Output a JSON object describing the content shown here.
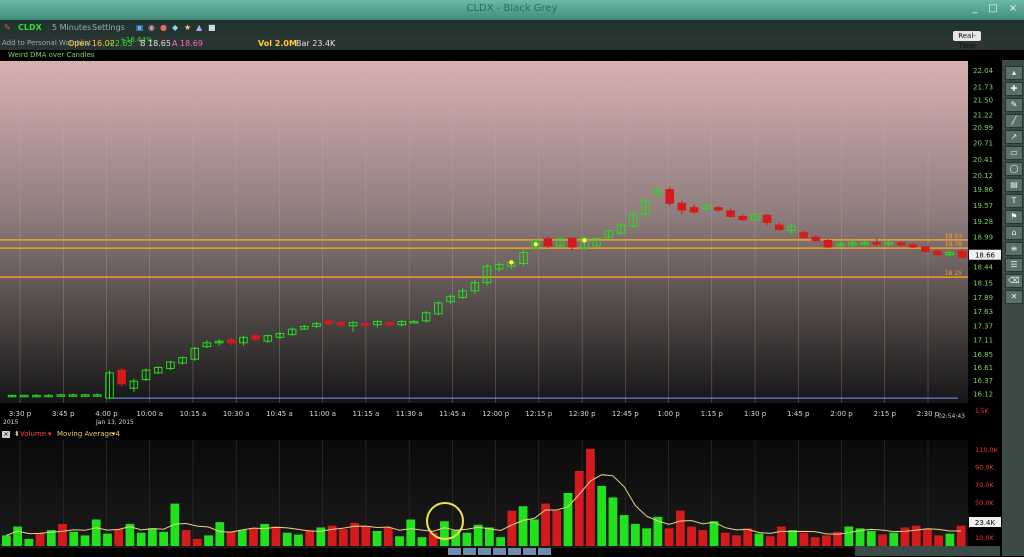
{
  "window": {
    "title": "CLDX - Black Grey",
    "min": "_",
    "max": "□",
    "close": "×"
  },
  "toolbar": {
    "symbol": "CLDX",
    "timeframe": "5 Minutes",
    "settings": "Settings",
    "watchlist": "Add to Personal Watchlist"
  },
  "quote": {
    "open": "Open 16.02",
    "change": "+2.63",
    "change_pct": "+16.44%",
    "bid": "B 18.65",
    "ask": "A 18.69",
    "vol": "Vol 2.0M",
    "bar": "Bar 23.4K"
  },
  "study_label": "Weird DMA over Candles",
  "realtime_button": "Real-Time",
  "price_axis": [
    "22.04",
    "21.73",
    "21.50",
    "21.22",
    "20.99",
    "20.71",
    "20.41",
    "20.12",
    "19.86",
    "19.57",
    "19.28",
    "18.99",
    "18.70",
    "18.44",
    "18.15",
    "17.89",
    "17.63",
    "17.37",
    "17.11",
    "16.85",
    "16.61",
    "16.37",
    "16.12"
  ],
  "current_price": "18.66",
  "line_labels": {
    "upper1": "18.93",
    "upper2": "18.78",
    "lower": "18.25"
  },
  "time_axis": [
    {
      "t": 0,
      "label": "3:30 p"
    },
    {
      "t": 1,
      "label": "3:45 p"
    },
    {
      "t": 2,
      "label": "4:00 p"
    },
    {
      "t": 3,
      "label": "10:00 a"
    },
    {
      "t": 4,
      "label": "10:15 a"
    },
    {
      "t": 5,
      "label": "10:30 a"
    },
    {
      "t": 6,
      "label": "10:45 a"
    },
    {
      "t": 7,
      "label": "11:00 a"
    },
    {
      "t": 8,
      "label": "11:15 a"
    },
    {
      "t": 9,
      "label": "11:30 a"
    },
    {
      "t": 10,
      "label": "11:45 a"
    },
    {
      "t": 11,
      "label": "12:00 p"
    },
    {
      "t": 12,
      "label": "12:15 p"
    },
    {
      "t": 13,
      "label": "12:30 p"
    },
    {
      "t": 14,
      "label": "12:45 p"
    },
    {
      "t": 15,
      "label": "1:00 p"
    },
    {
      "t": 16,
      "label": "1:15 p"
    },
    {
      "t": 17,
      "label": "1:30 p"
    },
    {
      "t": 18,
      "label": "1:45 p"
    },
    {
      "t": 19,
      "label": "2:00 p"
    },
    {
      "t": 20,
      "label": "2:15 p"
    },
    {
      "t": 21,
      "label": "2:30 p"
    }
  ],
  "date_labels": {
    "prev": "2015",
    "day": "Jan 13, 2015"
  },
  "clock": "02:54:43",
  "volume": {
    "label": "Volume",
    "ma_label": "Moving Average 4",
    "axis": [
      "110.0K",
      "90.0K",
      "70.0K",
      "50.0K",
      "30.0K",
      "10.0K"
    ],
    "current": "23.4K",
    "scale_label": "1.5K"
  },
  "colors": {
    "up": "#22e01c",
    "down": "#d41a1a",
    "support": "#f0a030",
    "blue_line": "#7f95ff"
  },
  "chart_data": {
    "type": "candlestick",
    "ylim": [
      15.95,
      22.2
    ],
    "candles": [
      {
        "o": 16.07,
        "c": 16.09,
        "h": 16.1,
        "l": 16.06
      },
      {
        "o": 16.07,
        "c": 16.09,
        "h": 16.1,
        "l": 16.06
      },
      {
        "o": 16.07,
        "c": 16.09,
        "h": 16.11,
        "l": 16.06
      },
      {
        "o": 16.07,
        "c": 16.09,
        "h": 16.11,
        "l": 16.06
      },
      {
        "o": 16.08,
        "c": 16.1,
        "h": 16.12,
        "l": 16.07
      },
      {
        "o": 16.08,
        "c": 16.1,
        "h": 16.12,
        "l": 16.07
      },
      {
        "o": 16.08,
        "c": 16.1,
        "h": 16.12,
        "l": 16.07
      },
      {
        "o": 16.08,
        "c": 16.1,
        "h": 16.12,
        "l": 16.07
      },
      {
        "o": 16.04,
        "c": 16.5,
        "h": 16.55,
        "l": 16.02
      },
      {
        "o": 16.55,
        "c": 16.3,
        "h": 16.6,
        "l": 16.25
      },
      {
        "o": 16.22,
        "c": 16.35,
        "h": 16.4,
        "l": 16.15
      },
      {
        "o": 16.38,
        "c": 16.55,
        "h": 16.58,
        "l": 16.35
      },
      {
        "o": 16.5,
        "c": 16.6,
        "h": 16.62,
        "l": 16.48
      },
      {
        "o": 16.58,
        "c": 16.7,
        "h": 16.72,
        "l": 16.55
      },
      {
        "o": 16.68,
        "c": 16.78,
        "h": 16.8,
        "l": 16.65
      },
      {
        "o": 16.75,
        "c": 16.95,
        "h": 16.98,
        "l": 16.72
      },
      {
        "o": 16.98,
        "c": 17.05,
        "h": 17.1,
        "l": 16.95
      },
      {
        "o": 17.05,
        "c": 17.08,
        "h": 17.12,
        "l": 17.0
      },
      {
        "o": 17.1,
        "c": 17.05,
        "h": 17.15,
        "l": 17.0
      },
      {
        "o": 17.05,
        "c": 17.15,
        "h": 17.18,
        "l": 17.0
      },
      {
        "o": 17.18,
        "c": 17.12,
        "h": 17.22,
        "l": 17.08
      },
      {
        "o": 17.08,
        "c": 17.18,
        "h": 17.2,
        "l": 17.05
      },
      {
        "o": 17.15,
        "c": 17.22,
        "h": 17.25,
        "l": 17.12
      },
      {
        "o": 17.2,
        "c": 17.3,
        "h": 17.33,
        "l": 17.18
      },
      {
        "o": 17.3,
        "c": 17.35,
        "h": 17.38,
        "l": 17.28
      },
      {
        "o": 17.35,
        "c": 17.4,
        "h": 17.43,
        "l": 17.32
      },
      {
        "o": 17.45,
        "c": 17.4,
        "h": 17.48,
        "l": 17.36
      },
      {
        "o": 17.42,
        "c": 17.38,
        "h": 17.46,
        "l": 17.33
      },
      {
        "o": 17.36,
        "c": 17.42,
        "h": 17.45,
        "l": 17.25
      },
      {
        "o": 17.4,
        "c": 17.38,
        "h": 17.44,
        "l": 17.32
      },
      {
        "o": 17.38,
        "c": 17.44,
        "h": 17.46,
        "l": 17.33
      },
      {
        "o": 17.42,
        "c": 17.38,
        "h": 17.45,
        "l": 17.33
      },
      {
        "o": 17.38,
        "c": 17.44,
        "h": 17.46,
        "l": 17.35
      },
      {
        "o": 17.42,
        "c": 17.44,
        "h": 17.47,
        "l": 17.4
      },
      {
        "o": 17.45,
        "c": 17.6,
        "h": 17.63,
        "l": 17.42
      },
      {
        "o": 17.58,
        "c": 17.78,
        "h": 17.8,
        "l": 17.55
      },
      {
        "o": 17.8,
        "c": 17.9,
        "h": 17.93,
        "l": 17.75
      },
      {
        "o": 17.88,
        "c": 18.0,
        "h": 18.05,
        "l": 17.85
      },
      {
        "o": 18.0,
        "c": 18.15,
        "h": 18.2,
        "l": 17.95
      },
      {
        "o": 18.15,
        "c": 18.45,
        "h": 18.5,
        "l": 18.1
      },
      {
        "o": 18.4,
        "c": 18.48,
        "h": 18.52,
        "l": 18.35
      },
      {
        "o": 18.45,
        "c": 18.52,
        "h": 18.55,
        "l": 18.4
      },
      {
        "o": 18.5,
        "c": 18.7,
        "h": 18.75,
        "l": 18.45
      },
      {
        "o": 18.78,
        "c": 18.92,
        "h": 18.95,
        "l": 18.75
      },
      {
        "o": 18.95,
        "c": 18.82,
        "h": 19.0,
        "l": 18.78
      },
      {
        "o": 18.82,
        "c": 18.95,
        "h": 18.98,
        "l": 18.78
      },
      {
        "o": 18.96,
        "c": 18.8,
        "h": 18.98,
        "l": 18.75
      },
      {
        "o": 18.78,
        "c": 18.96,
        "h": 18.98,
        "l": 18.75
      },
      {
        "o": 18.82,
        "c": 18.96,
        "h": 18.98,
        "l": 18.78
      },
      {
        "o": 18.98,
        "c": 19.1,
        "h": 19.12,
        "l": 18.95
      },
      {
        "o": 19.05,
        "c": 19.2,
        "h": 19.25,
        "l": 19.02
      },
      {
        "o": 19.18,
        "c": 19.4,
        "h": 19.45,
        "l": 19.15
      },
      {
        "o": 19.4,
        "c": 19.65,
        "h": 19.7,
        "l": 19.38
      },
      {
        "o": 19.75,
        "c": 19.85,
        "h": 19.9,
        "l": 19.72
      },
      {
        "o": 19.85,
        "c": 19.6,
        "h": 19.9,
        "l": 19.55
      },
      {
        "o": 19.6,
        "c": 19.48,
        "h": 19.65,
        "l": 19.4
      },
      {
        "o": 19.52,
        "c": 19.44,
        "h": 19.58,
        "l": 19.4
      },
      {
        "o": 19.5,
        "c": 19.56,
        "h": 19.6,
        "l": 19.46
      },
      {
        "o": 19.52,
        "c": 19.48,
        "h": 19.55,
        "l": 19.44
      },
      {
        "o": 19.46,
        "c": 19.36,
        "h": 19.5,
        "l": 19.33
      },
      {
        "o": 19.36,
        "c": 19.3,
        "h": 19.4,
        "l": 19.27
      },
      {
        "o": 19.3,
        "c": 19.4,
        "h": 19.43,
        "l": 19.26
      },
      {
        "o": 19.38,
        "c": 19.25,
        "h": 19.4,
        "l": 19.2
      },
      {
        "o": 19.2,
        "c": 19.12,
        "h": 19.25,
        "l": 19.1
      },
      {
        "o": 19.1,
        "c": 19.18,
        "h": 19.22,
        "l": 19.05
      },
      {
        "o": 19.06,
        "c": 18.98,
        "h": 19.1,
        "l": 18.95
      },
      {
        "o": 18.98,
        "c": 18.92,
        "h": 19.02,
        "l": 18.9
      },
      {
        "o": 18.92,
        "c": 18.8,
        "h": 18.95,
        "l": 18.78
      },
      {
        "o": 18.82,
        "c": 18.86,
        "h": 18.95,
        "l": 18.8
      },
      {
        "o": 18.84,
        "c": 18.88,
        "h": 18.95,
        "l": 18.8
      },
      {
        "o": 18.86,
        "c": 18.88,
        "h": 18.92,
        "l": 18.83
      },
      {
        "o": 18.88,
        "c": 18.86,
        "h": 18.96,
        "l": 18.82
      },
      {
        "o": 18.86,
        "c": 18.88,
        "h": 18.92,
        "l": 18.82
      },
      {
        "o": 18.88,
        "c": 18.84,
        "h": 18.9,
        "l": 18.8
      },
      {
        "o": 18.84,
        "c": 18.8,
        "h": 18.88,
        "l": 18.78
      },
      {
        "o": 18.8,
        "c": 18.72,
        "h": 18.82,
        "l": 18.7
      },
      {
        "o": 18.72,
        "c": 18.66,
        "h": 18.75,
        "l": 18.64
      },
      {
        "o": 18.66,
        "c": 18.7,
        "h": 18.73,
        "l": 18.62
      },
      {
        "o": 18.72,
        "c": 18.66,
        "h": 18.76,
        "l": 18.64
      }
    ],
    "volume": [
      12,
      22,
      8,
      15,
      18,
      25,
      16,
      12,
      30,
      14,
      19,
      25,
      15,
      20,
      16,
      48,
      18,
      8,
      12,
      27,
      16,
      18,
      20,
      25,
      22,
      15,
      13,
      18,
      21,
      23,
      19,
      26,
      22,
      17,
      21,
      11,
      30,
      10,
      15,
      28,
      18,
      15,
      24,
      21,
      10,
      40,
      45,
      30,
      48,
      40,
      60,
      85,
      110,
      68,
      55,
      35,
      25,
      20,
      33,
      20,
      40,
      22,
      18,
      28,
      15,
      12,
      20,
      14,
      11,
      22,
      18,
      15,
      10,
      12,
      16,
      22,
      20,
      17,
      13,
      15,
      21,
      23,
      19,
      12,
      14,
      23
    ],
    "volume_max": 120
  }
}
